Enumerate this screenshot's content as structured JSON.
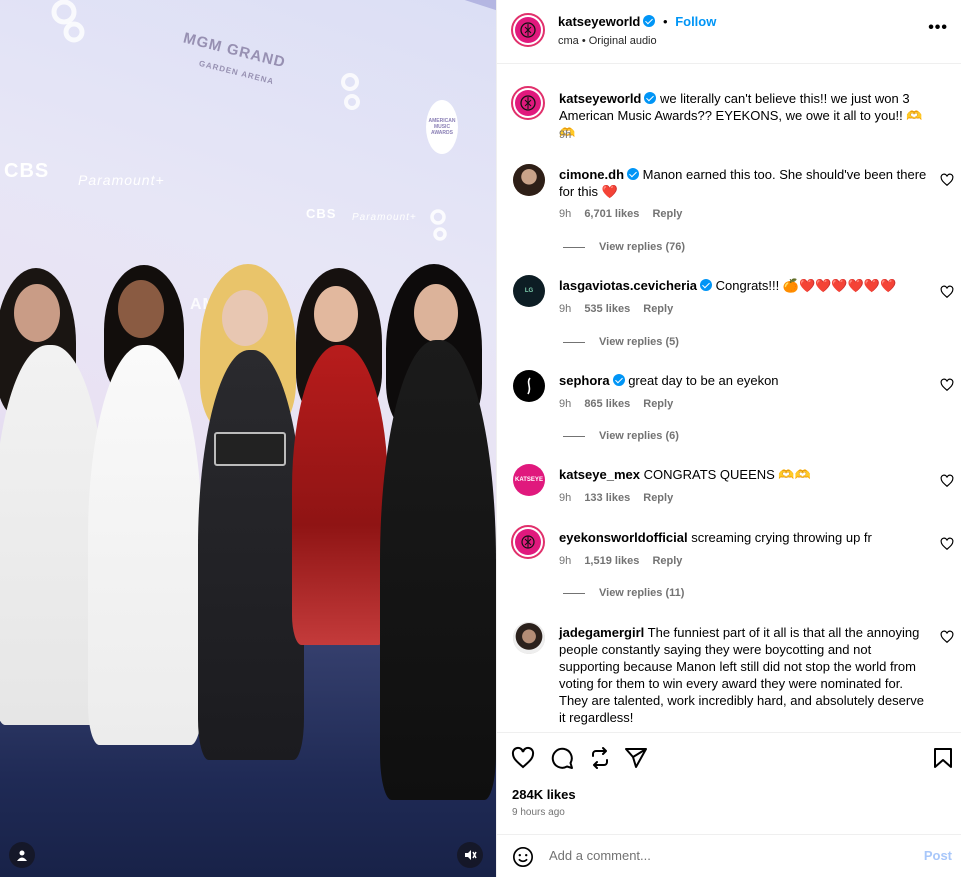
{
  "media": {
    "backdrop_texts": {
      "mgm": "MGM GRAND",
      "garden": "GARDEN ARENA",
      "cbs": "CBS",
      "paramount": "Paramount+",
      "cbs2": "CBS",
      "paramount2": "Paramount+",
      "ama_badge": "AMERICAN MUSIC AWARDS",
      "amer": "AMER"
    }
  },
  "post": {
    "author": "katseyeworld",
    "follow_label": "Follow",
    "dot": "•",
    "subtitle": "cma • Original audio",
    "more_label": "•••"
  },
  "caption": {
    "username": "katseyeworld",
    "text": "we literally can't believe this!! we just won 3 American Music Awards?? EYEKONS, we owe it all to you!! 🫶🫶",
    "time": "9h"
  },
  "comments": [
    {
      "username": "cimone.dh",
      "verified": true,
      "text": "Manon earned this too. She should've been there for this ❤️",
      "time": "9h",
      "likes": "6,701 likes",
      "reply": "Reply",
      "replies": "View replies (76)"
    },
    {
      "username": "lasgaviotas.cevicheria",
      "verified": true,
      "text": "Congrats!!! 🍊❤️❤️❤️❤️❤️❤️",
      "time": "9h",
      "likes": "535 likes",
      "reply": "Reply",
      "replies": "View replies (5)"
    },
    {
      "username": "sephora",
      "verified": true,
      "text": "great day to be an eyekon",
      "time": "9h",
      "likes": "865 likes",
      "reply": "Reply",
      "replies": "View replies (6)"
    },
    {
      "username": "katseye_mex",
      "verified": false,
      "text": "CONGRATS QUEENS 🫶🫶",
      "time": "9h",
      "likes": "133 likes",
      "reply": "Reply",
      "replies": ""
    },
    {
      "username": "eyekonsworldofficial",
      "verified": false,
      "text": "screaming crying throwing up fr",
      "time": "9h",
      "likes": "1,519 likes",
      "reply": "Reply",
      "replies": "View replies (11)"
    },
    {
      "username": "jadegamergirl",
      "verified": false,
      "text": "The funniest part of it all is that all the annoying people constantly saying they were boycotting and not supporting because Manon left still did not stop the world from voting for them to win every award they were nominated for. They are talented, work incredibly hard, and absolutely deserve it regardless!",
      "time": "",
      "likes": "",
      "reply": "",
      "replies": ""
    }
  ],
  "footer": {
    "likes": "284K likes",
    "time": "9 hours ago",
    "add_comment_placeholder": "Add a comment...",
    "post_label": "Post"
  },
  "icons": {
    "like": "heart-icon",
    "comment": "comment-icon",
    "share": "share-icon",
    "send": "send-icon",
    "save": "bookmark-icon",
    "emoji": "emoji-icon",
    "more": "more-icon",
    "mute": "mute-icon",
    "tag": "user-tag-icon"
  },
  "colors": {
    "accent": "#0095f6",
    "brand": "#e1306c",
    "muted": "#737373"
  }
}
